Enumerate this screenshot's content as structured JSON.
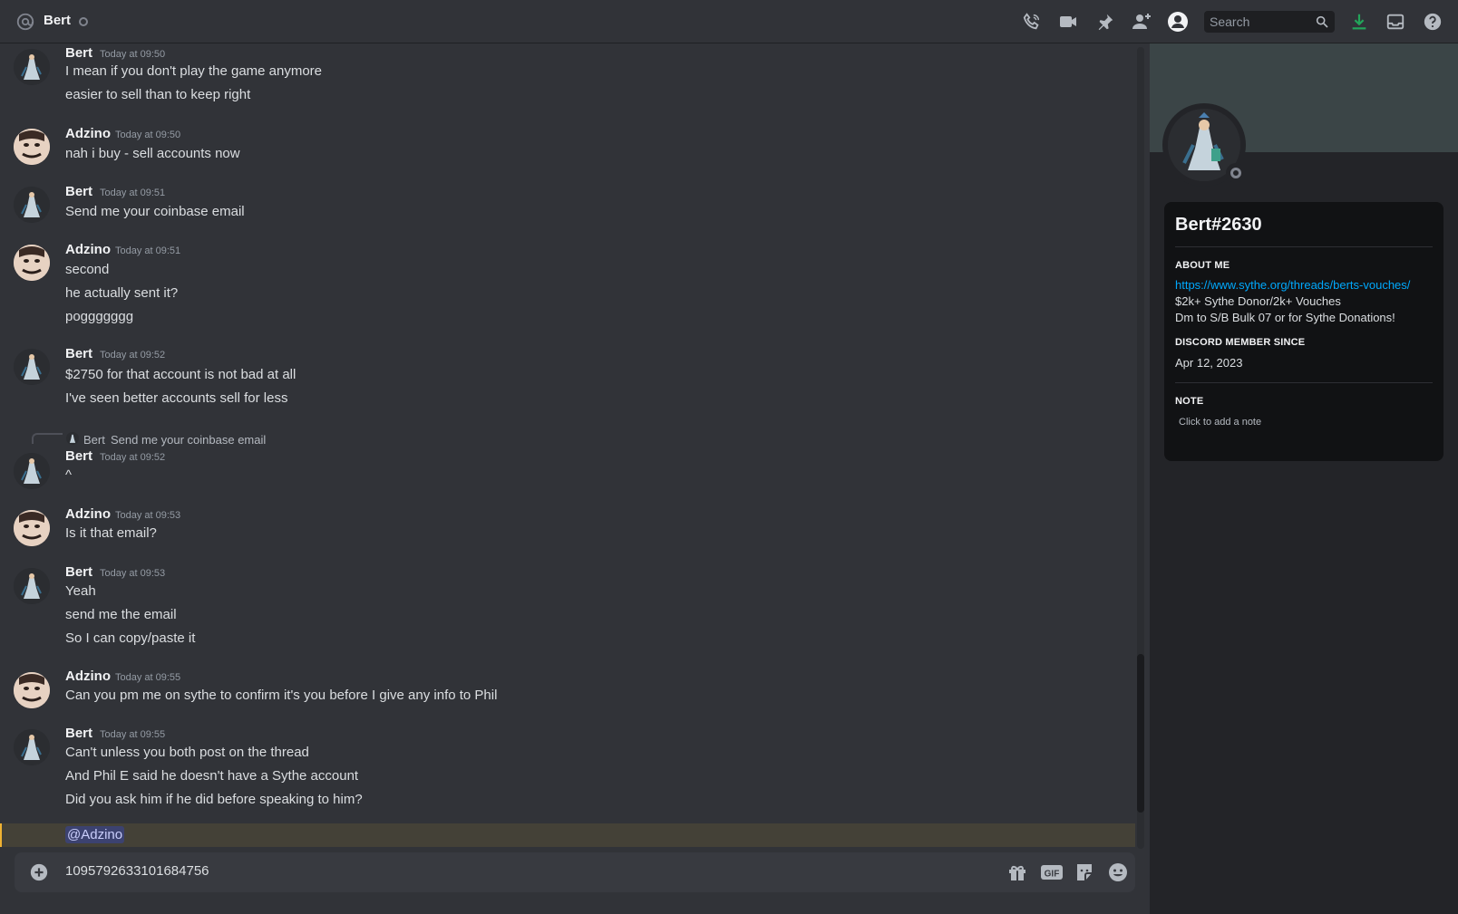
{
  "header": {
    "title": "Bert",
    "search_placeholder": "Search",
    "icons": [
      "at-icon",
      "call-icon",
      "video-icon",
      "pin-icon",
      "add-friend-icon",
      "user-profile-icon",
      "download-icon",
      "inbox-icon",
      "help-icon"
    ]
  },
  "messages": [
    {
      "author": "Bert",
      "time": "Today at 09:50",
      "lines": [
        "I mean if you don't play the game anymore",
        "easier to sell than to keep right"
      ]
    },
    {
      "author": "Adzino",
      "time": "Today at 09:50",
      "lines": [
        "nah i buy - sell accounts now"
      ]
    },
    {
      "author": "Bert",
      "time": "Today at 09:51",
      "lines": [
        "Send me your coinbase email"
      ]
    },
    {
      "author": "Adzino",
      "time": "Today at 09:51",
      "lines": [
        "second",
        "he actually sent it?",
        "poggggggg"
      ]
    },
    {
      "author": "Bert",
      "time": "Today at 09:52",
      "lines": [
        "$2750 for that account is not bad at all",
        "I've seen better accounts sell for less"
      ]
    },
    {
      "author": "Bert",
      "time": "Today at 09:52",
      "lines": [
        "^"
      ]
    },
    {
      "author": "Adzino",
      "time": "Today at 09:53",
      "lines": [
        "Is it that email?"
      ]
    },
    {
      "author": "Bert",
      "time": "Today at 09:53",
      "lines": [
        "Yeah",
        "send me the email",
        "So I can copy/paste it"
      ]
    },
    {
      "author": "Adzino",
      "time": "Today at 09:55",
      "lines": [
        "Can you pm me on sythe to confirm it's you before I give any info to Phil"
      ]
    },
    {
      "author": "Bert",
      "time": "Today at 09:55",
      "lines": [
        "Can't unless you both post on the thread",
        "And Phil E said he doesn't have a Sythe account",
        "Did you ask him if he did before speaking to him?"
      ]
    }
  ],
  "reply": {
    "author": "Bert",
    "text": "Send me your coinbase email"
  },
  "mention": "@Adzino",
  "composer": {
    "value": "1095792633101684756"
  },
  "profile": {
    "username": "Bert#2630",
    "about_heading": "ABOUT ME",
    "about_link": "https://www.sythe.org/threads/berts-vouches/",
    "about_line1": "$2k+ Sythe Donor/2k+ Vouches",
    "about_line2": "Dm to S/B Bulk 07 or for Sythe Donations!",
    "member_heading": "DISCORD MEMBER SINCE",
    "member_since": "Apr 12, 2023",
    "note_heading": "NOTE",
    "note_placeholder": "Click to add a note"
  },
  "colors": {
    "background": "#313338",
    "panel": "#232428",
    "card": "#111214",
    "link": "#00a8fc",
    "mention_bg": "#444137",
    "mention_bar": "#f0b232"
  }
}
